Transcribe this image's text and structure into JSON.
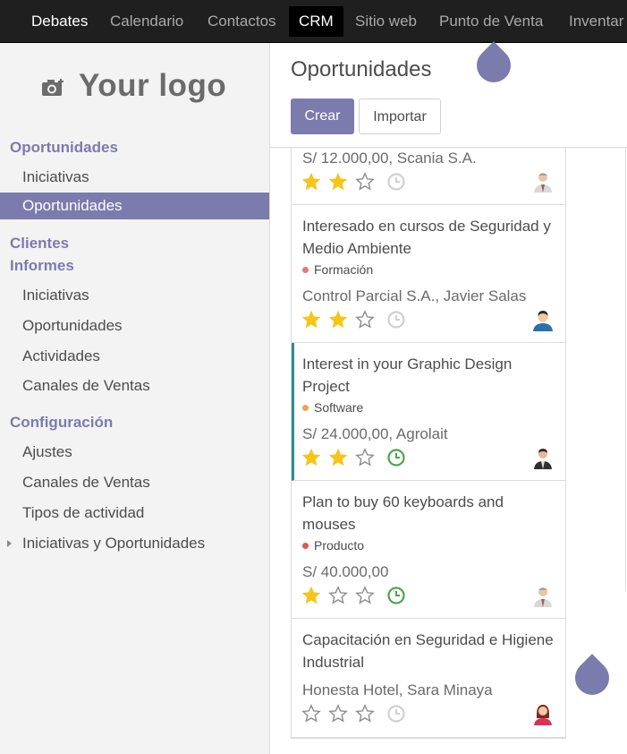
{
  "navbar": {
    "items": [
      {
        "label": "Debates"
      },
      {
        "label": "Calendario"
      },
      {
        "label": "Contactos"
      },
      {
        "label": "CRM"
      },
      {
        "label": "Sitio web"
      },
      {
        "label": "Punto de Venta"
      },
      {
        "label": "Inventar"
      }
    ],
    "active": "CRM"
  },
  "sidebar": {
    "logo_text": "Your logo",
    "sections": {
      "oportunidades": "Oportunidades",
      "clientes": "Clientes",
      "informes": "Informes",
      "configuracion": "Configuración"
    },
    "items": {
      "iniciativas": "Iniciativas",
      "oportunidades": "Oportunidades",
      "inf_iniciativas": "Iniciativas",
      "inf_oportunidades": "Oportunidades",
      "inf_actividades": "Actividades",
      "inf_canales": "Canales de Ventas",
      "ajustes": "Ajustes",
      "canales": "Canales de Ventas",
      "tipos": "Tipos de actividad",
      "iniciativas_oport": "Iniciativas y Oportunidades"
    }
  },
  "main": {
    "title": "Oportunidades",
    "create_label": "Crear",
    "import_label": "Importar"
  },
  "cards": [
    {
      "name": "",
      "tag": "",
      "info": "S/ 12.000,00, Scania S.A.",
      "stars": 2,
      "activity": "none",
      "avatar": "man-gray"
    },
    {
      "name": "Interesado en cursos de Seguridad y Medio Ambiente",
      "tag": "Formación",
      "tag_color": "#e07a7a",
      "info": "Control Parcial S.A., Javier Salas",
      "stars": 2,
      "activity": "none",
      "avatar": "user-blue"
    },
    {
      "name": "Interest in your Graphic Design Project",
      "tag": "Software",
      "tag_color": "#f0a050",
      "info": "S/ 24.000,00, Agrolait",
      "stars": 2,
      "activity": "planned",
      "avatar": "man-dark"
    },
    {
      "name": "Plan to buy 60 keyboards and mouses",
      "tag": "Producto",
      "tag_color": "#e05555",
      "info": "S/ 40.000,00",
      "stars": 1,
      "activity": "planned",
      "avatar": "man-gray"
    },
    {
      "name": "Capacitación en Seguridad e Higiene Industrial",
      "tag": "",
      "info": "Honesta Hotel, Sara Minaya",
      "stars": 0,
      "activity": "none",
      "avatar": "woman-red"
    }
  ],
  "colors": {
    "accent": "#7c7bad",
    "star_on": "#f5c518",
    "clock_planned": "#4ca54c",
    "card_highlight": "#2e8e8f"
  }
}
